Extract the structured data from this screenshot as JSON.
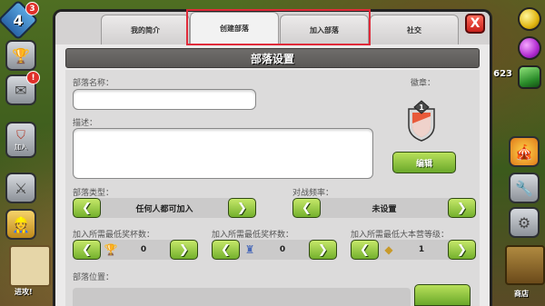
{
  "hud": {
    "level": "4",
    "level_notification": "3",
    "mail_notification": "!",
    "clan_button_label": "加入",
    "progress_label": "进攻!",
    "gem_count": "623",
    "right_label": "商店"
  },
  "tabs": [
    {
      "label": "我的简介"
    },
    {
      "label": "创建部落"
    },
    {
      "label": "加入部落"
    },
    {
      "label": "社交"
    }
  ],
  "close_label": "X",
  "section_title": "部落设置",
  "form": {
    "name_label": "部落名称：",
    "name_value": "",
    "description_label": "描述：",
    "description_value": "",
    "badge_label": "徽章：",
    "badge_level": "1",
    "edit_button": "编辑",
    "clan_type_label": "部落类型：",
    "clan_type_value": "任何人都可加入",
    "war_frequency_label": "对战频率：",
    "war_frequency_value": "未设置",
    "min_trophies_label": "加入所需最低奖杯数：",
    "min_trophies_value": "0",
    "min_builder_trophies_label": "加入所需最低奖杯数：",
    "min_builder_trophies_value": "0",
    "min_townhall_label": "加入所需最低大本营等级：",
    "min_townhall_value": "1",
    "location_label": "部落位置：",
    "arrow_left": "❮",
    "arrow_right": "❯"
  },
  "colors": {
    "accent_green": "#74b02c",
    "highlight_red": "#e02b3a",
    "close_red": "#c8201a",
    "header_gray": "#5a5856"
  },
  "icons": {
    "trophy": "trophy-icon",
    "builder_trophy": "builder-trophy-icon",
    "townhall": "townhall-icon",
    "badge": "clan-badge-icon"
  }
}
